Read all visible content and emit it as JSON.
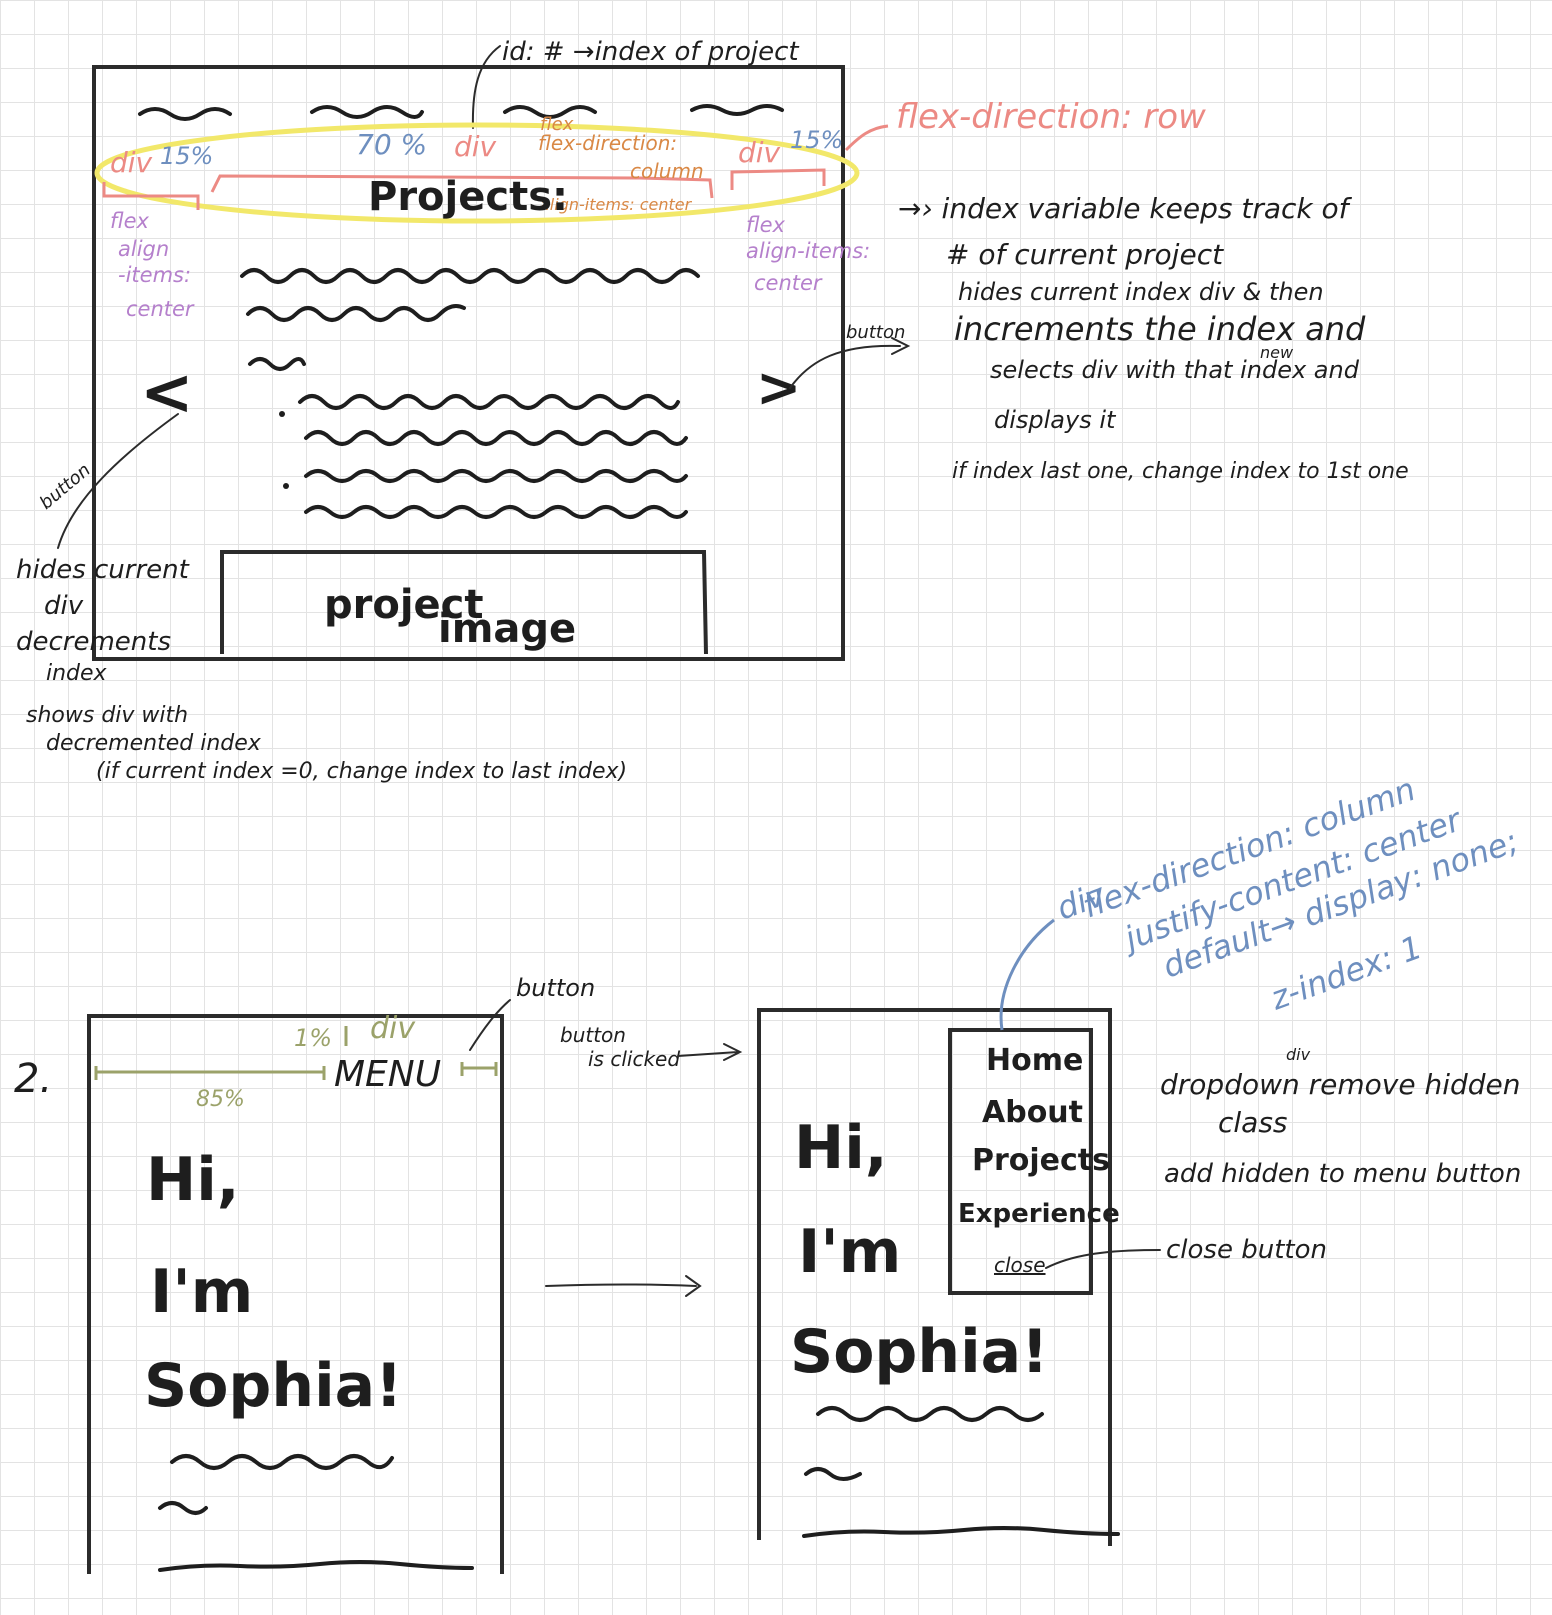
{
  "sketch1": {
    "id_note": "id: # →index of project",
    "div_left": "div",
    "pct_left": "15%",
    "pct_center": "70 %",
    "div_center": "div",
    "flex_center_1": "flex",
    "flex_center_2": "flex-direction:",
    "flex_center_3": "column",
    "align_center": "align-items: center",
    "div_right": "div",
    "pct_right": "15%",
    "flex_direction_row": "flex-direction: row",
    "left_flex": [
      "flex",
      "align",
      "-items:",
      "center"
    ],
    "right_flex": [
      "flex",
      "align-items:",
      "center"
    ],
    "title": "Projects:",
    "prev_arrow": "<",
    "next_arrow": ">",
    "button_right": "button",
    "button_left": "button",
    "image_line1": "project",
    "image_line2": "image",
    "next_notes": [
      "→› index  variable  keeps  track  of",
      "# of  current  project",
      "hides  current  index div & then",
      "increments  the  index  and",
      "selects  div  with  that  index  and",
      "displays  it",
      "if  index  last  one,  change  index  to 1st one"
    ],
    "next_notes_new": "new",
    "prev_notes": [
      "hides current",
      "div",
      "decrements",
      "index",
      "shows div with",
      "decremented  index",
      "(if  current  index =0,  change  index  to  last  index)"
    ]
  },
  "sketch2": {
    "number": "2.",
    "pct_small": "1%",
    "div_label": "div",
    "menu_label": "MENU",
    "button_label": "button",
    "pct_85": "85%",
    "hero": [
      "Hi,",
      "I'm",
      "Sophia!"
    ],
    "clicked_note": [
      "button",
      "is clicked"
    ],
    "div_notes": [
      "div",
      "flex-direction: column",
      "justify-content: center",
      "default→ display: none;",
      "z-index: 1"
    ],
    "menu_items": [
      "Home",
      "About",
      "Projects",
      "Experience",
      "close"
    ],
    "close_button_label": "close button",
    "dropdown_notes": [
      "dropdown  remove  hidden",
      "class",
      "add  hidden  to  menu  button"
    ],
    "dropdown_div": "div"
  }
}
